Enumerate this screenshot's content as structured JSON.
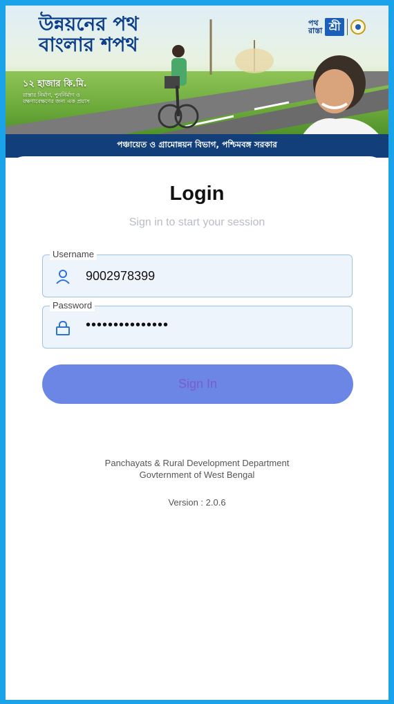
{
  "banner": {
    "headline_line1": "উন্নয়নের পথ",
    "headline_line2": "বাংলার শপথ",
    "sub_line1": "১২ হাজার কি.মি.",
    "sub_line2": "রাস্তার নির্মাণ, পুনর্নির্মাণ ও রক্ষণাবেক্ষণের জন্য এক প্রয়াস",
    "logo_text_top": "পথ",
    "logo_text_bottom": "রাস্তা",
    "logo_mark": "শ্রী",
    "department_bn": "পঞ্চায়েত ও গ্রামোন্নয়ন বিভাগ, পশ্চিমবঙ্গ সরকার"
  },
  "login": {
    "title": "Login",
    "subtitle": "Sign in to start your session",
    "username_label": "Username",
    "username_value": "9002978399",
    "password_label": "Password",
    "password_value": "•••••••••••••••",
    "signin_label": "Sign In"
  },
  "footer": {
    "line1": "Panchayats & Rural Development Department",
    "line2": "Govternment of West Bengal",
    "version": "Version :  2.0.6"
  },
  "colors": {
    "frame": "#1aa3e8",
    "banner_bar": "#123f7a",
    "button": "#6b86e4",
    "field_border": "#9cc3e6"
  },
  "icons": [
    "user-icon",
    "lock-icon",
    "state-emblem-icon"
  ]
}
